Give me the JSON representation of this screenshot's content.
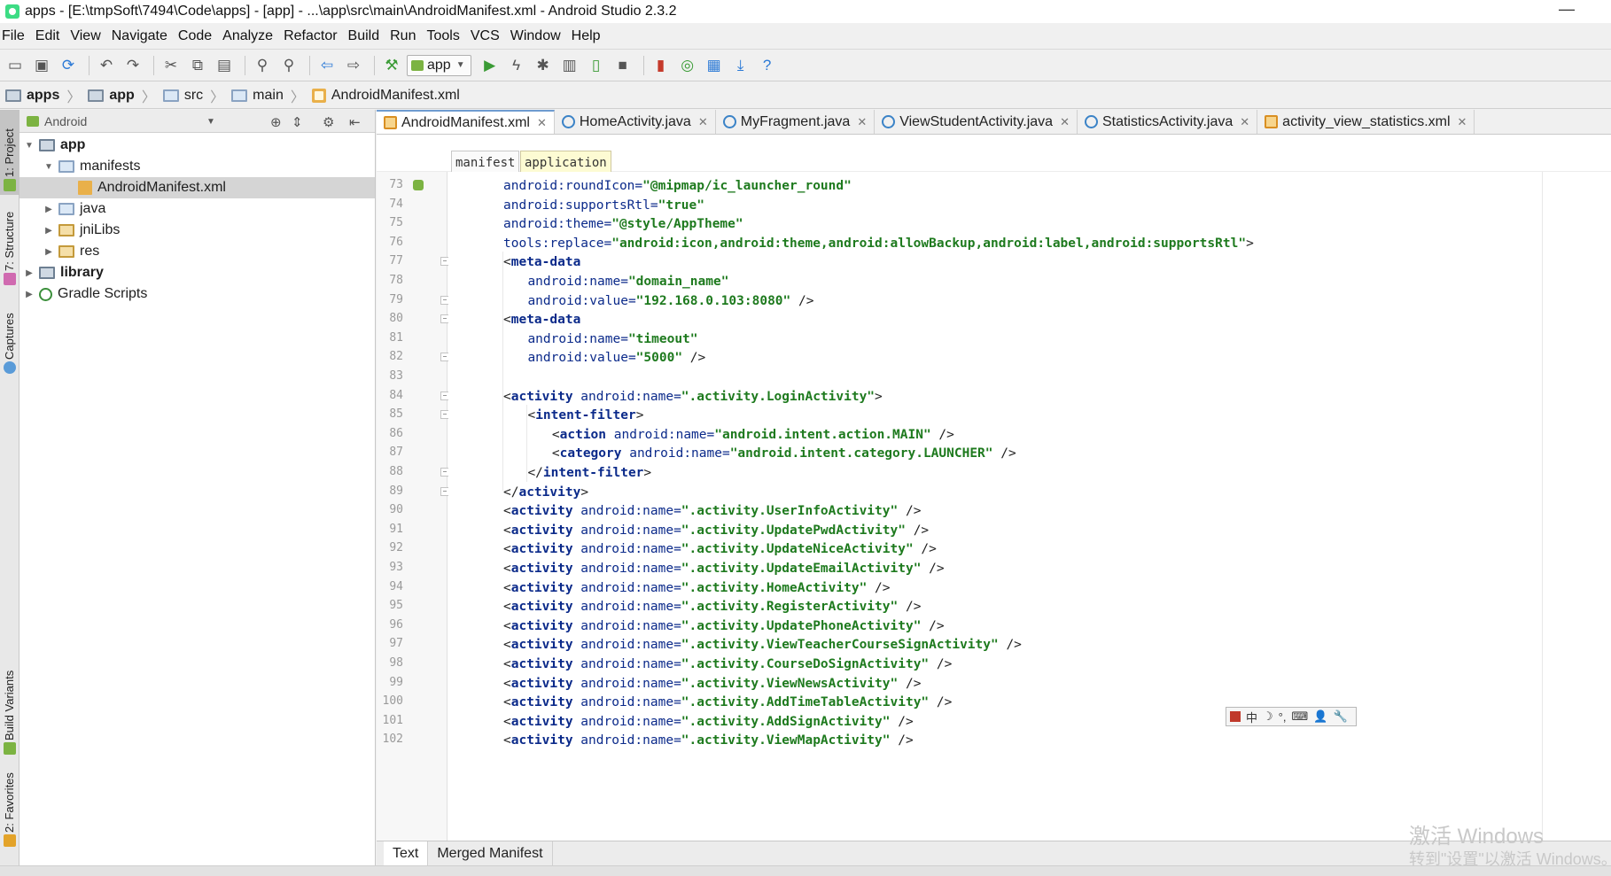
{
  "window": {
    "title": "apps - [E:\\tmpSoft\\7494\\Code\\apps] - [app] - ...\\app\\src\\main\\AndroidManifest.xml - Android Studio 2.3.2",
    "minimize": "—"
  },
  "menu": [
    "File",
    "Edit",
    "View",
    "Navigate",
    "Code",
    "Analyze",
    "Refactor",
    "Build",
    "Run",
    "Tools",
    "VCS",
    "Window",
    "Help"
  ],
  "toolbar": {
    "run_config": "app",
    "icons": [
      "open-icon",
      "save-all-icon",
      "sync-icon",
      "undo-icon",
      "redo-icon",
      "cut-icon",
      "copy-icon",
      "paste-icon",
      "find-icon",
      "replace-icon",
      "back-icon",
      "forward-icon",
      "make-icon",
      "run-icon",
      "apply-changes-icon",
      "debug-icon",
      "profile-icon",
      "attach-icon",
      "stop-icon",
      "avd-manager-icon",
      "gradle-sync-icon",
      "sdk-manager-icon",
      "device-monitor-icon",
      "help-icon"
    ]
  },
  "breadcrumb": [
    "apps",
    "app",
    "src",
    "main",
    "AndroidManifest.xml"
  ],
  "left_strip": {
    "tabs": [
      "1: Project",
      "7: Structure",
      "Captures",
      "Build Variants",
      "2: Favorites"
    ]
  },
  "project": {
    "view_mode": "Android",
    "tree": [
      {
        "label": "app",
        "bold": true,
        "level": 0,
        "expanded": true,
        "icon": "module"
      },
      {
        "label": "manifests",
        "bold": false,
        "level": 1,
        "expanded": true,
        "icon": "folder"
      },
      {
        "label": "AndroidManifest.xml",
        "bold": false,
        "level": 2,
        "expanded": null,
        "icon": "manifest",
        "selected": true
      },
      {
        "label": "java",
        "bold": false,
        "level": 1,
        "expanded": false,
        "icon": "folder"
      },
      {
        "label": "jniLibs",
        "bold": false,
        "level": 1,
        "expanded": false,
        "icon": "folder-lib"
      },
      {
        "label": "res",
        "bold": false,
        "level": 1,
        "expanded": false,
        "icon": "folder-lib"
      },
      {
        "label": "library",
        "bold": true,
        "level": 0,
        "expanded": false,
        "icon": "module"
      },
      {
        "label": "Gradle Scripts",
        "bold": false,
        "level": 0,
        "expanded": false,
        "icon": "gradle"
      }
    ]
  },
  "editor": {
    "tabs": [
      {
        "label": "AndroidManifest.xml",
        "type": "xml",
        "active": true
      },
      {
        "label": "HomeActivity.java",
        "type": "java",
        "active": false
      },
      {
        "label": "MyFragment.java",
        "type": "java",
        "active": false
      },
      {
        "label": "ViewStudentActivity.java",
        "type": "java",
        "active": false
      },
      {
        "label": "StatisticsActivity.java",
        "type": "java",
        "active": false
      },
      {
        "label": "activity_view_statistics.xml",
        "type": "xml",
        "active": false
      }
    ],
    "xml_path": [
      "manifest",
      "application"
    ],
    "lines": [
      {
        "n": "73",
        "indent": 1,
        "parts": [
          [
            "attr",
            "android:roundIcon="
          ],
          [
            "val",
            "\"@mipmap/ic_launcher_round\""
          ]
        ],
        "mark": "android"
      },
      {
        "n": "74",
        "indent": 1,
        "parts": [
          [
            "attr",
            "android:supportsRtl="
          ],
          [
            "val",
            "\"true\""
          ]
        ]
      },
      {
        "n": "75",
        "indent": 1,
        "parts": [
          [
            "attr",
            "android:theme="
          ],
          [
            "val",
            "\"@style/AppTheme\""
          ]
        ]
      },
      {
        "n": "76",
        "indent": 1,
        "parts": [
          [
            "attr",
            "tools:replace="
          ],
          [
            "val",
            "\"android:icon,android:theme,android:allowBackup,android:label,android:supportsRtl\""
          ],
          [
            "punct",
            ">"
          ]
        ]
      },
      {
        "n": "77",
        "indent": 1,
        "parts": [
          [
            "punct",
            "<"
          ],
          [
            "tag",
            "meta-data"
          ]
        ],
        "fold": "open"
      },
      {
        "n": "78",
        "indent": 2,
        "parts": [
          [
            "attr",
            "android:name="
          ],
          [
            "val",
            "\"domain_name\""
          ]
        ]
      },
      {
        "n": "79",
        "indent": 2,
        "parts": [
          [
            "attr",
            "android:value="
          ],
          [
            "val",
            "\"192.168.0.103:8080\""
          ],
          [
            "punct",
            " />"
          ]
        ],
        "fold": "close"
      },
      {
        "n": "80",
        "indent": 1,
        "parts": [
          [
            "punct",
            "<"
          ],
          [
            "tag",
            "meta-data"
          ]
        ],
        "fold": "open"
      },
      {
        "n": "81",
        "indent": 2,
        "parts": [
          [
            "attr",
            "android:name="
          ],
          [
            "val",
            "\"timeout\""
          ]
        ]
      },
      {
        "n": "82",
        "indent": 2,
        "parts": [
          [
            "attr",
            "android:value="
          ],
          [
            "val",
            "\"5000\""
          ],
          [
            "punct",
            " />"
          ]
        ],
        "fold": "close"
      },
      {
        "n": "83",
        "indent": 1,
        "parts": []
      },
      {
        "n": "84",
        "indent": 1,
        "parts": [
          [
            "punct",
            "<"
          ],
          [
            "tag",
            "activity"
          ],
          [
            "attr",
            " android:name="
          ],
          [
            "val",
            "\".activity.LoginActivity\""
          ],
          [
            "punct",
            ">"
          ]
        ],
        "fold": "open"
      },
      {
        "n": "85",
        "indent": 2,
        "parts": [
          [
            "punct",
            "<"
          ],
          [
            "tag",
            "intent-filter"
          ],
          [
            "punct",
            ">"
          ]
        ],
        "fold": "open"
      },
      {
        "n": "86",
        "indent": 3,
        "parts": [
          [
            "punct",
            "<"
          ],
          [
            "tag",
            "action"
          ],
          [
            "attr",
            " android:name="
          ],
          [
            "val",
            "\"android.intent.action.MAIN\""
          ],
          [
            "punct",
            " />"
          ]
        ]
      },
      {
        "n": "87",
        "indent": 3,
        "parts": [
          [
            "punct",
            "<"
          ],
          [
            "tag",
            "category"
          ],
          [
            "attr",
            " android:name="
          ],
          [
            "val",
            "\"android.intent.category.LAUNCHER\""
          ],
          [
            "punct",
            " />"
          ]
        ]
      },
      {
        "n": "88",
        "indent": 2,
        "parts": [
          [
            "punct",
            "</"
          ],
          [
            "tag",
            "intent-filter"
          ],
          [
            "punct",
            ">"
          ]
        ],
        "fold": "close"
      },
      {
        "n": "89",
        "indent": 1,
        "parts": [
          [
            "punct",
            "</"
          ],
          [
            "tag",
            "activity"
          ],
          [
            "punct",
            ">"
          ]
        ],
        "fold": "close"
      },
      {
        "n": "90",
        "indent": 1,
        "parts": [
          [
            "punct",
            "<"
          ],
          [
            "tag",
            "activity"
          ],
          [
            "attr",
            " android:name="
          ],
          [
            "val",
            "\".activity.UserInfoActivity\""
          ],
          [
            "punct",
            " />"
          ]
        ]
      },
      {
        "n": "91",
        "indent": 1,
        "parts": [
          [
            "punct",
            "<"
          ],
          [
            "tag",
            "activity"
          ],
          [
            "attr",
            " android:name="
          ],
          [
            "val",
            "\".activity.UpdatePwdActivity\""
          ],
          [
            "punct",
            " />"
          ]
        ]
      },
      {
        "n": "92",
        "indent": 1,
        "parts": [
          [
            "punct",
            "<"
          ],
          [
            "tag",
            "activity"
          ],
          [
            "attr",
            " android:name="
          ],
          [
            "val",
            "\".activity.UpdateNiceActivity\""
          ],
          [
            "punct",
            " />"
          ]
        ]
      },
      {
        "n": "93",
        "indent": 1,
        "parts": [
          [
            "punct",
            "<"
          ],
          [
            "tag",
            "activity"
          ],
          [
            "attr",
            " android:name="
          ],
          [
            "val",
            "\".activity.UpdateEmailActivity\""
          ],
          [
            "punct",
            " />"
          ]
        ]
      },
      {
        "n": "94",
        "indent": 1,
        "parts": [
          [
            "punct",
            "<"
          ],
          [
            "tag",
            "activity"
          ],
          [
            "attr",
            " android:name="
          ],
          [
            "val",
            "\".activity.HomeActivity\""
          ],
          [
            "punct",
            " />"
          ]
        ]
      },
      {
        "n": "95",
        "indent": 1,
        "parts": [
          [
            "punct",
            "<"
          ],
          [
            "tag",
            "activity"
          ],
          [
            "attr",
            " android:name="
          ],
          [
            "val",
            "\".activity.RegisterActivity\""
          ],
          [
            "punct",
            " />"
          ]
        ]
      },
      {
        "n": "96",
        "indent": 1,
        "parts": [
          [
            "punct",
            "<"
          ],
          [
            "tag",
            "activity"
          ],
          [
            "attr",
            " android:name="
          ],
          [
            "val",
            "\".activity.UpdatePhoneActivity\""
          ],
          [
            "punct",
            " />"
          ]
        ]
      },
      {
        "n": "97",
        "indent": 1,
        "parts": [
          [
            "punct",
            "<"
          ],
          [
            "tag",
            "activity"
          ],
          [
            "attr",
            " android:name="
          ],
          [
            "val",
            "\".activity.ViewTeacherCourseSignActivity\""
          ],
          [
            "punct",
            " />"
          ]
        ]
      },
      {
        "n": "98",
        "indent": 1,
        "parts": [
          [
            "punct",
            "<"
          ],
          [
            "tag",
            "activity"
          ],
          [
            "attr",
            " android:name="
          ],
          [
            "val",
            "\".activity.CourseDoSignActivity\""
          ],
          [
            "punct",
            " />"
          ]
        ]
      },
      {
        "n": "99",
        "indent": 1,
        "parts": [
          [
            "punct",
            "<"
          ],
          [
            "tag",
            "activity"
          ],
          [
            "attr",
            " android:name="
          ],
          [
            "val",
            "\".activity.ViewNewsActivity\""
          ],
          [
            "punct",
            " />"
          ]
        ]
      },
      {
        "n": "100",
        "indent": 1,
        "parts": [
          [
            "punct",
            "<"
          ],
          [
            "tag",
            "activity"
          ],
          [
            "attr",
            " android:name="
          ],
          [
            "val",
            "\".activity.AddTimeTableActivity\""
          ],
          [
            "punct",
            " />"
          ]
        ]
      },
      {
        "n": "101",
        "indent": 1,
        "parts": [
          [
            "punct",
            "<"
          ],
          [
            "tag",
            "activity"
          ],
          [
            "attr",
            " android:name="
          ],
          [
            "val",
            "\".activity.AddSignActivity\""
          ],
          [
            "punct",
            " />"
          ]
        ]
      },
      {
        "n": "102",
        "indent": 1,
        "parts": [
          [
            "punct",
            "<"
          ],
          [
            "tag",
            "activity"
          ],
          [
            "attr",
            " android:name="
          ],
          [
            "val",
            "\".activity.ViewMapActivity\""
          ],
          [
            "punct",
            " />"
          ]
        ]
      }
    ],
    "bottom_tabs": [
      {
        "label": "Text",
        "active": true
      },
      {
        "label": "Merged Manifest",
        "active": false
      }
    ]
  },
  "ime_toolbar": [
    "中",
    "☽",
    "°,",
    "⌨",
    "👤",
    "🔧"
  ],
  "watermark": {
    "line1": "激活 Windows",
    "line2": "转到\"设置\"以激活 Windows。"
  },
  "colors": {
    "attr": "#0b2a8a",
    "value": "#1e7a1e",
    "active_tab_border": "#6e9bd0",
    "selected_row": "#d5d5d5"
  }
}
